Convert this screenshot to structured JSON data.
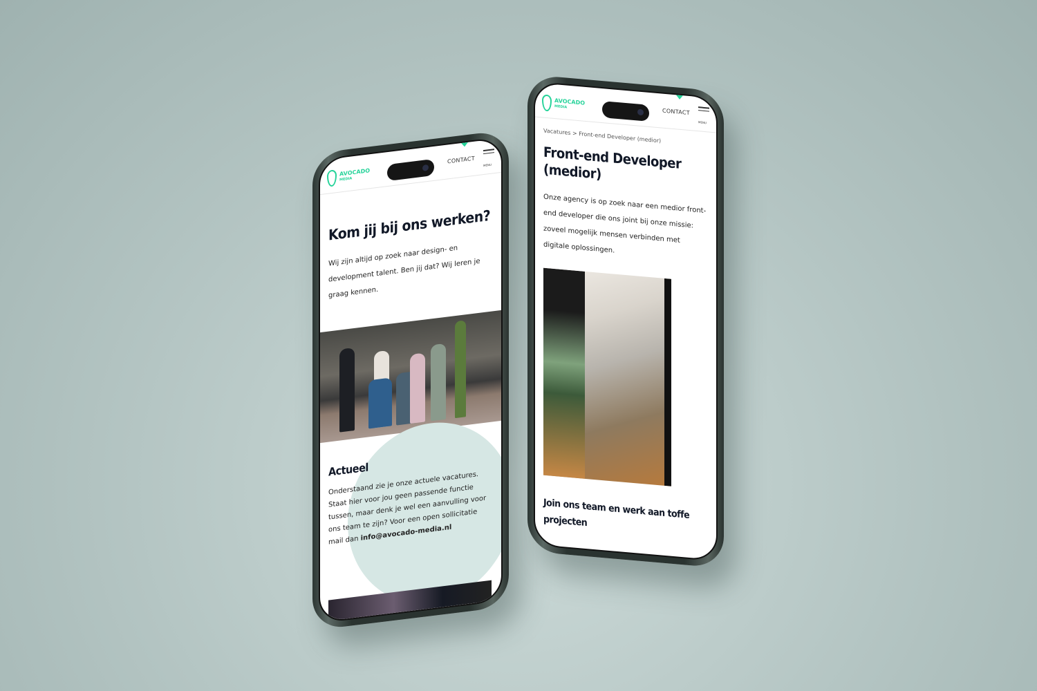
{
  "brand": {
    "name": "AVOCADO",
    "sub": "MEDIA",
    "accent": "#27d39a"
  },
  "nav": {
    "contact": "CONTACT",
    "menu": "MENU"
  },
  "left": {
    "title": "Kom jij bij ons werken?",
    "intro": "Wij zijn altijd op zoek naar design- en development talent. Ben jij dat? Wij leren je graag kennen.",
    "section_title": "Actueel",
    "section_text": "Onderstaand zie je onze actuele vacatures. Staat hier voor jou geen passende functie tussen, maar denk je wel een aanvulling voor ons team te zijn? Voor een open sollicitatie mail dan",
    "email": "info@avocado-media.nl"
  },
  "right": {
    "breadcrumb": {
      "parent": "Vacatures",
      "sep": ">",
      "current": "Front-end Developer (medior)"
    },
    "title": "Front-end Developer (medior)",
    "intro": "Onze agency is op zoek naar een medior front-end developer die ons joint bij onze missie: zoveel mogelijk mensen verbinden met digitale oplossingen.",
    "subtitle": "Join ons team en werk aan toffe projecten"
  }
}
